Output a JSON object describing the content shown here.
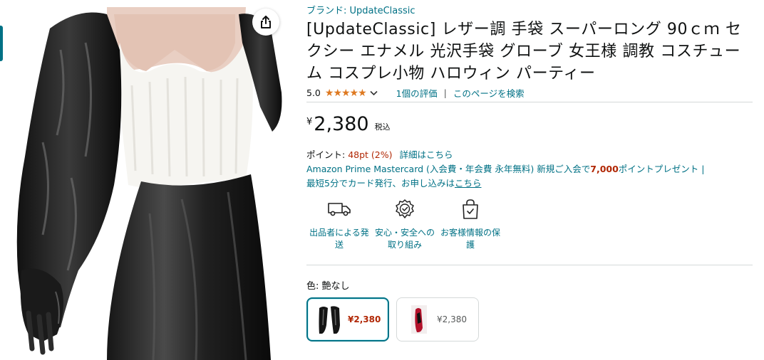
{
  "image": {
    "alt": "product-photo",
    "share_icon": "share-icon"
  },
  "product": {
    "brand_link": "ブランド: UpdateClassic",
    "title": "[UpdateClassic] レザー調 手袋 スーパーロング 90ｃｍ セクシー エナメル 光沢手袋 グローブ 女王様 調教 コスチューム コスプレ小物 ハロウィン パーティー",
    "rating_value": "5.0",
    "stars": "★★★★★",
    "rating_count": "1個の評価",
    "separator": "|",
    "search_page": "このページを検索"
  },
  "price": {
    "symbol": "¥",
    "amount": "2,380",
    "tax": "税込"
  },
  "points": {
    "label": "ポイント: ",
    "value": "48pt  (2%)",
    "details": "詳細はこちら"
  },
  "mastercard": {
    "line1_prefix": "Amazon Prime Mastercard (入会費・年会費 永年無料) 新規ご入会で",
    "line1_bold": "7,000",
    "line1_suffix": "ポイントプレゼント |",
    "line2_prefix": "最短5分でカード発行、お申し込みは",
    "line2_link": "こちら"
  },
  "badges": [
    {
      "icon": "delivery-truck-icon",
      "label": "出品者による発送"
    },
    {
      "icon": "security-badge-icon",
      "label": "安心・安全への取り組み"
    },
    {
      "icon": "secure-bag-icon",
      "label": "お客様情報の保護"
    }
  ],
  "variation": {
    "label": "色: ",
    "selected": "艶なし",
    "options": [
      {
        "price": "¥2,380",
        "selected": true
      },
      {
        "price": "¥2,380",
        "selected": false
      }
    ]
  },
  "colors": {
    "link": "#007185",
    "price_red": "#b12704",
    "star": "#de7921"
  }
}
